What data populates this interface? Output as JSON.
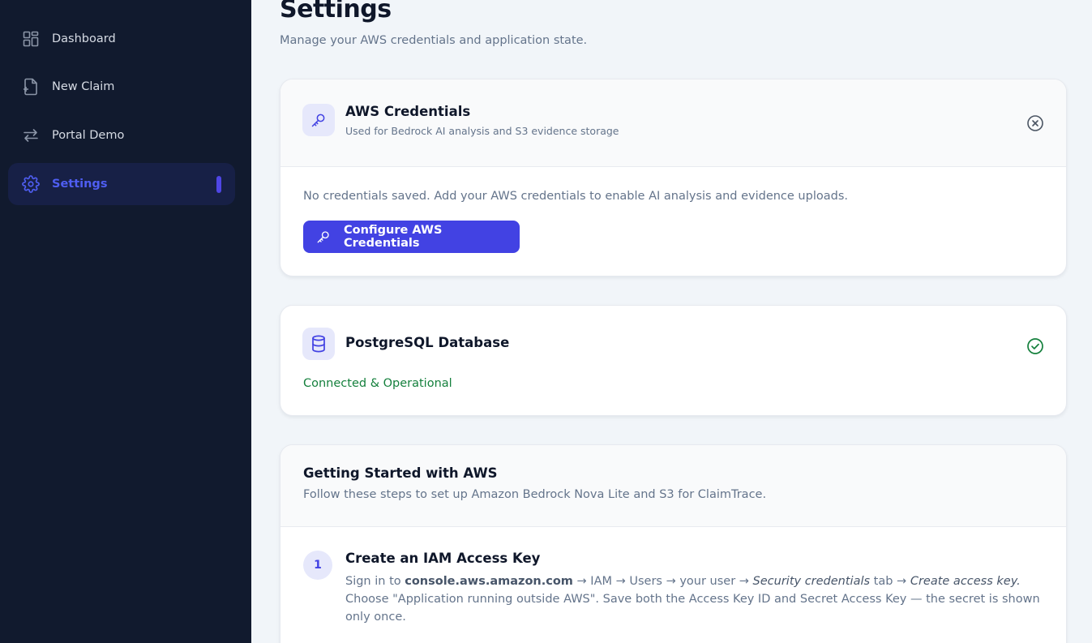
{
  "sidebar": {
    "items": [
      {
        "label": "Dashboard",
        "icon": "dashboard-icon",
        "active": false
      },
      {
        "label": "New Claim",
        "icon": "file-plus-icon",
        "active": false
      },
      {
        "label": "Portal Demo",
        "icon": "arrows-swap-icon",
        "active": false
      },
      {
        "label": "Settings",
        "icon": "gear-icon",
        "active": true
      }
    ]
  },
  "page": {
    "title": "Settings",
    "subtitle": "Manage your AWS credentials and application state."
  },
  "aws_card": {
    "title": "AWS Credentials",
    "subtitle": "Used for Bedrock AI analysis and S3 evidence storage",
    "status_icon": "x-circle-icon",
    "message": "No credentials saved. Add your AWS credentials to enable AI analysis and evidence uploads.",
    "button_label": "Configure AWS Credentials"
  },
  "db_card": {
    "title": "PostgreSQL Database",
    "status_icon": "check-circle-icon",
    "status_text": "Connected & Operational"
  },
  "getting_started": {
    "title": "Getting Started with AWS",
    "subtitle": "Follow these steps to set up Amazon Bedrock Nova Lite and S3 for ClaimTrace.",
    "steps": [
      {
        "number": "1",
        "title": "Create an IAM Access Key",
        "text_1": "Sign in to ",
        "text_bold": "console.aws.amazon.com",
        "text_2": " → IAM → Users → your user → ",
        "text_italic_1": "Security credentials",
        "text_3": " tab → ",
        "text_italic_2": "Create access key.",
        "text_4": " Choose \"Application running outside AWS\". Save both the Access Key ID and Secret Access Key — the secret is shown only once."
      }
    ]
  },
  "colors": {
    "sidebar_bg": "#111a2e",
    "accent": "#4242e3",
    "success": "#15803d",
    "muted": "#64748b"
  }
}
